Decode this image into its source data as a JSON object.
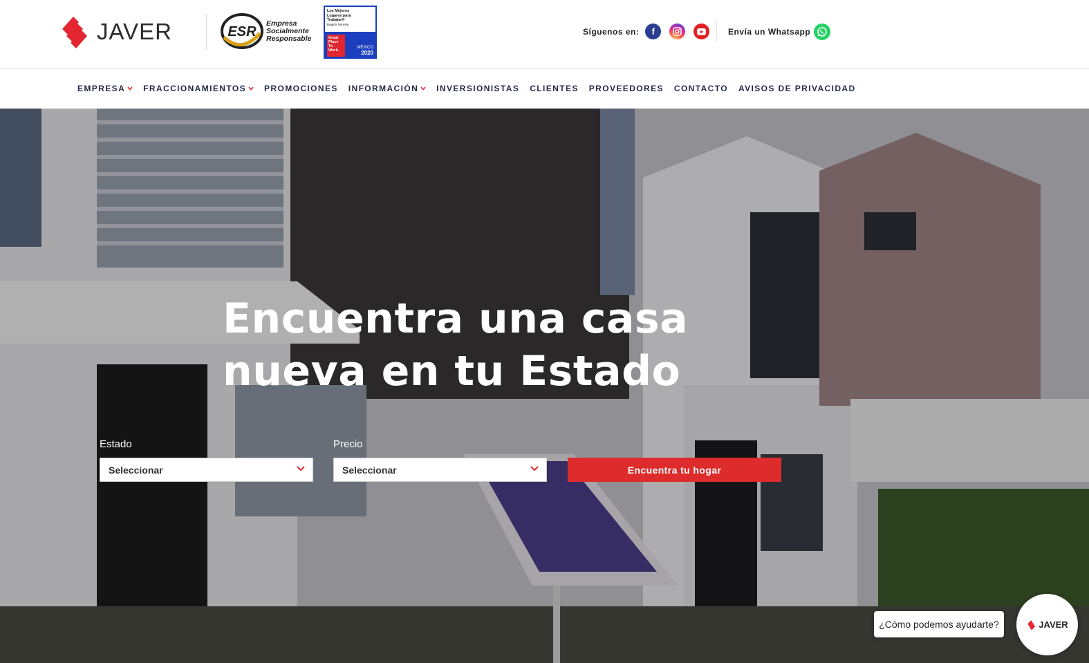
{
  "header": {
    "brand": "JAVER",
    "esr_text_1": "Empresa",
    "esr_text_2": "Socialmente",
    "esr_text_3": "Responsable",
    "esr_badge": "ESR",
    "gptw_line1": "Los Mejores",
    "gptw_line2": "Lugares para",
    "gptw_line3": "Trabajar®",
    "gptw_line4": "Región Noreste",
    "gptw_red": "Great Place To Work.",
    "gptw_country": "MÉXICO",
    "gptw_year": "2020",
    "social_label": "Síguenos en:",
    "social_icons": [
      "facebook-icon",
      "instagram-icon",
      "youtube-icon"
    ],
    "whatsapp_label": "Envía un Whatsapp"
  },
  "nav": {
    "items": [
      {
        "label": "EMPRESA",
        "has_dropdown": true
      },
      {
        "label": "FRACCIONAMIENTOS",
        "has_dropdown": true
      },
      {
        "label": "PROMOCIONES",
        "has_dropdown": false
      },
      {
        "label": "INFORMACIÓN",
        "has_dropdown": true
      },
      {
        "label": "INVERSIONISTAS",
        "has_dropdown": false
      },
      {
        "label": "CLIENTES",
        "has_dropdown": false
      },
      {
        "label": "PROVEEDORES",
        "has_dropdown": false
      },
      {
        "label": "CONTACTO",
        "has_dropdown": false
      },
      {
        "label": "AVISOS DE PRIVACIDAD",
        "has_dropdown": false
      }
    ]
  },
  "hero": {
    "headline_line1": "Encuentra una casa",
    "headline_line2": "nueva en tu Estado",
    "estado_label": "Estado",
    "estado_value": "Seleccionar",
    "precio_label": "Precio",
    "precio_value": "Seleccionar",
    "cta_label": "Encuentra tu hogar"
  },
  "chat": {
    "bubble_text": "¿Cómo podemos ayudarte?",
    "avatar_brand": "JAVER"
  },
  "colors": {
    "brand_red": "#de2b2b",
    "nav_text": "#1f2a44",
    "whatsapp_green": "#25d366"
  }
}
